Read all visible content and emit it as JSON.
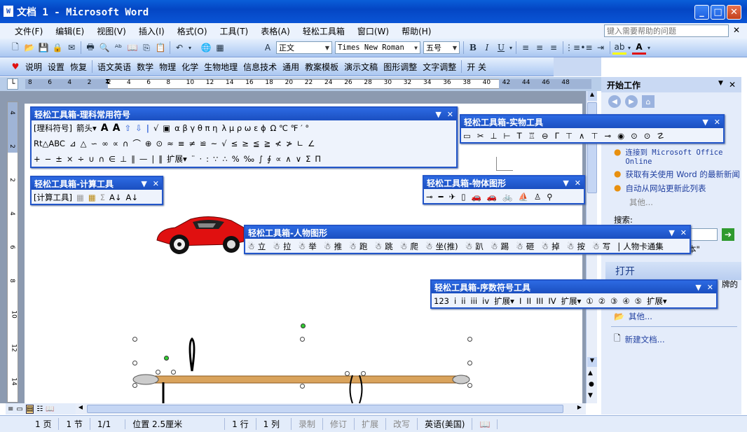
{
  "window": {
    "title": "文档 1 - Microsoft Word",
    "icon_label": "W"
  },
  "menu": {
    "items": [
      "文件(F)",
      "编辑(E)",
      "视图(V)",
      "插入(I)",
      "格式(O)",
      "工具(T)",
      "表格(A)",
      "轻松工具箱",
      "窗口(W)",
      "帮助(H)"
    ],
    "help_placeholder": "键入需要帮助的问题"
  },
  "format": {
    "style": "正文",
    "font": "Times New Roman",
    "size": "五号"
  },
  "toolbar3": {
    "items": [
      "说明",
      "设置",
      "恢复",
      "语文英语",
      "数学",
      "物理",
      "化学",
      "生物地理",
      "信息技术",
      "通用",
      "教案模板",
      "演示文稿",
      "图形调整",
      "文字调整",
      "开 关"
    ]
  },
  "ruler": {
    "ticks": [
      "8",
      "6",
      "4",
      "2",
      "2",
      "4",
      "6",
      "8",
      "10",
      "12",
      "14",
      "16",
      "18",
      "20",
      "22",
      "24",
      "26",
      "28",
      "30",
      "32",
      "34",
      "36",
      "38",
      "40",
      "42",
      "44",
      "46",
      "48"
    ]
  },
  "vruler": {
    "ticks": [
      "4",
      "2",
      "2",
      "4",
      "6",
      "8",
      "10",
      "12",
      "14"
    ]
  },
  "tb_symbols": {
    "title": "轻松工具箱-理科常用符号",
    "row1": [
      "[理科符号]",
      "箭头▾",
      "A",
      "A",
      "⇧",
      "⇩",
      "|",
      "√",
      "▣",
      "α β γ θ π η",
      "λ μ ρ ω ε ϕ",
      "Ω ℃ ℉ ′ °"
    ],
    "row2": [
      "Rt△ABC",
      "⊿",
      "△",
      "∽",
      "∞",
      "∝",
      "∩",
      "⌒",
      "⊕",
      "⊙",
      "≈",
      "≡",
      "≠",
      "≌",
      "~",
      "√",
      "≤",
      "≥",
      "≦",
      "≧",
      "≮",
      "≯",
      "∟",
      "∠"
    ],
    "row3": [
      "+",
      "−",
      "±",
      "×",
      "÷",
      "∪",
      "∩",
      "∈",
      "⊥",
      "∥",
      "—",
      "|",
      "‖",
      "扩展▾",
      "¨",
      "·",
      ":",
      "∵",
      "∴",
      "%",
      "‰",
      "∫",
      "∮",
      "∝",
      "∧",
      "∨",
      "Σ",
      "Π"
    ]
  },
  "tb_calc": {
    "title": "轻松工具箱-计算工具",
    "items": [
      "[计算工具]",
      "▦",
      "▦",
      "Σ",
      "A↓",
      "A↓"
    ]
  },
  "tb_objects": {
    "title": "轻松工具箱-实物工具",
    "items": [
      "▭",
      "✂",
      "⊥",
      "⊢",
      "T",
      "♖",
      "⊖",
      "Γ",
      "⊤",
      "∧",
      "⊤",
      "⊸",
      "◉",
      "⊙",
      "⊙",
      "☡"
    ]
  },
  "tb_shapes": {
    "title": "轻松工具箱-物体图形",
    "items": [
      "⊸",
      "━",
      "✈",
      "▯",
      "🚗",
      "🚗",
      "🚲",
      "⛵",
      "♙",
      "⚲"
    ]
  },
  "tb_people": {
    "title": "轻松工具箱-人物图形",
    "items": [
      "立",
      "拉",
      "举",
      "推",
      "跑",
      "跳",
      "爬",
      "坐(推)",
      "趴",
      "踢",
      "砸",
      "掉",
      "按",
      "写",
      "人物卡通集"
    ]
  },
  "tb_numbers": {
    "title": "轻松工具箱-序数符号工具",
    "items": [
      "123",
      "i",
      "ii",
      "iii",
      "iv",
      "扩展▾",
      "I",
      "II",
      "III",
      "IV",
      "扩展▾",
      "①",
      "②",
      "③",
      "④",
      "⑤",
      "扩展▾"
    ]
  },
  "taskpane": {
    "title": "开始工作",
    "links": [
      "连接到 Microsoft Office Online",
      "获取有关使用 Word 的最新新闻",
      "自动从网站更新此列表"
    ],
    "more": "其他...",
    "search_label": "搜索:",
    "search_example": "本\"",
    "open_title": "打开",
    "open_partial": "牌的",
    "open_more": "其他...",
    "new_doc": "新建文档..."
  },
  "status": {
    "page": "1 页",
    "section": "1 节",
    "pages": "1/1",
    "position": "位置 2.5厘米",
    "line": "1 行",
    "column": "1 列",
    "modes": [
      "录制",
      "修订",
      "扩展",
      "改写"
    ],
    "language": "英语(美国)"
  },
  "colors": {
    "title_blue": "#0a55d6",
    "toolbar_title": "#1b4fc0",
    "car_red": "#e01010"
  }
}
